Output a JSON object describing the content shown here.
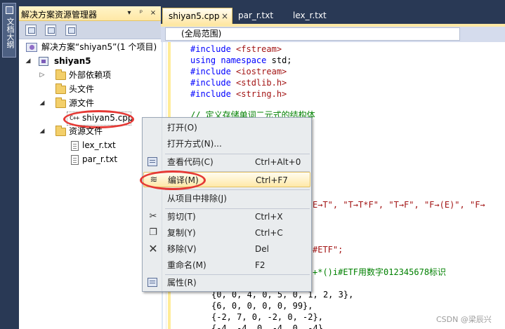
{
  "side_tab": {
    "label": "文档大纲"
  },
  "explorer": {
    "title": "解决方案资源管理器",
    "title_buttons": [
      "▾",
      "📌",
      "×"
    ],
    "solution_label": "解决方案“shiyan5”(1 个项目)",
    "project_label": "shiyan5",
    "external_deps": "外部依赖项",
    "header_files": "头文件",
    "source_files": "源文件",
    "source_file": "shiyan5.cpp",
    "resource_files": "资源文件",
    "resource_items": [
      "lex_r.txt",
      "par_r.txt"
    ],
    "cpp_icon_text": "C++"
  },
  "tabs": [
    {
      "label": "shiyan5.cpp",
      "active": true
    },
    {
      "label": "par_r.txt",
      "active": false
    },
    {
      "label": "lex_r.txt",
      "active": false
    }
  ],
  "scope_dropdown": "(全局范围)",
  "code": {
    "line1_pp": "#include",
    "line1_str": " <fstream>",
    "line2_kw1": "using",
    "line2_kw2": "namespace",
    "line2_rest": " std;",
    "line3_pp": "#include",
    "line3_str": " <iostream>",
    "line4_pp": "#include",
    "line4_str": " <stdlib.h>",
    "line5_pp": "#include",
    "line5_str": " <string.h>",
    "line6_cmt": "// 定义存储单词二元式的结构体",
    "line7_str": "E→T\", \"T→T*F\", \"T→F\", \"F→(E)\", \"F→",
    "line8_str": "#ETF\";",
    "line9_cmt": "+*()i#ETF用数字012345678标识",
    "row1": "{0, 0, 4, 0, 5, 0, 1, 2, 3},",
    "row2": "{6, 0, 0, 0, 0, 99},",
    "row3": "{-2, 7, 0, -2, 0, -2},",
    "row4": "{-4, -4, 0, -4, 0, -4}"
  },
  "context_menu": {
    "items": [
      {
        "label": "打开(O)",
        "shortcut": "",
        "icon": ""
      },
      {
        "label": "打开方式(N)...",
        "shortcut": "",
        "icon": ""
      },
      {
        "label": "查看代码(C)",
        "shortcut": "Ctrl+Alt+0",
        "icon": "view-code-icon"
      },
      {
        "label": "编译(M)",
        "shortcut": "Ctrl+F7",
        "icon": "compile-icon",
        "highlighted": true
      },
      {
        "label": "从项目中排除(J)",
        "shortcut": "",
        "icon": ""
      },
      {
        "label": "剪切(T)",
        "shortcut": "Ctrl+X",
        "icon": "scissors-icon"
      },
      {
        "label": "复制(Y)",
        "shortcut": "Ctrl+C",
        "icon": "copy-icon"
      },
      {
        "label": "移除(V)",
        "shortcut": "Del",
        "icon": "remove-icon"
      },
      {
        "label": "重命名(M)",
        "shortcut": "F2",
        "icon": ""
      },
      {
        "label": "属性(R)",
        "shortcut": "",
        "icon": "properties-icon"
      }
    ]
  },
  "watermark": "CSDN @梁辰兴",
  "colors": {
    "ide_background": "#293955",
    "highlight_gold": "#ffe8a6",
    "annotation_red": "#e53935",
    "keyword_blue": "#0000ff",
    "string_red": "#a31515",
    "comment_green": "#008000"
  }
}
